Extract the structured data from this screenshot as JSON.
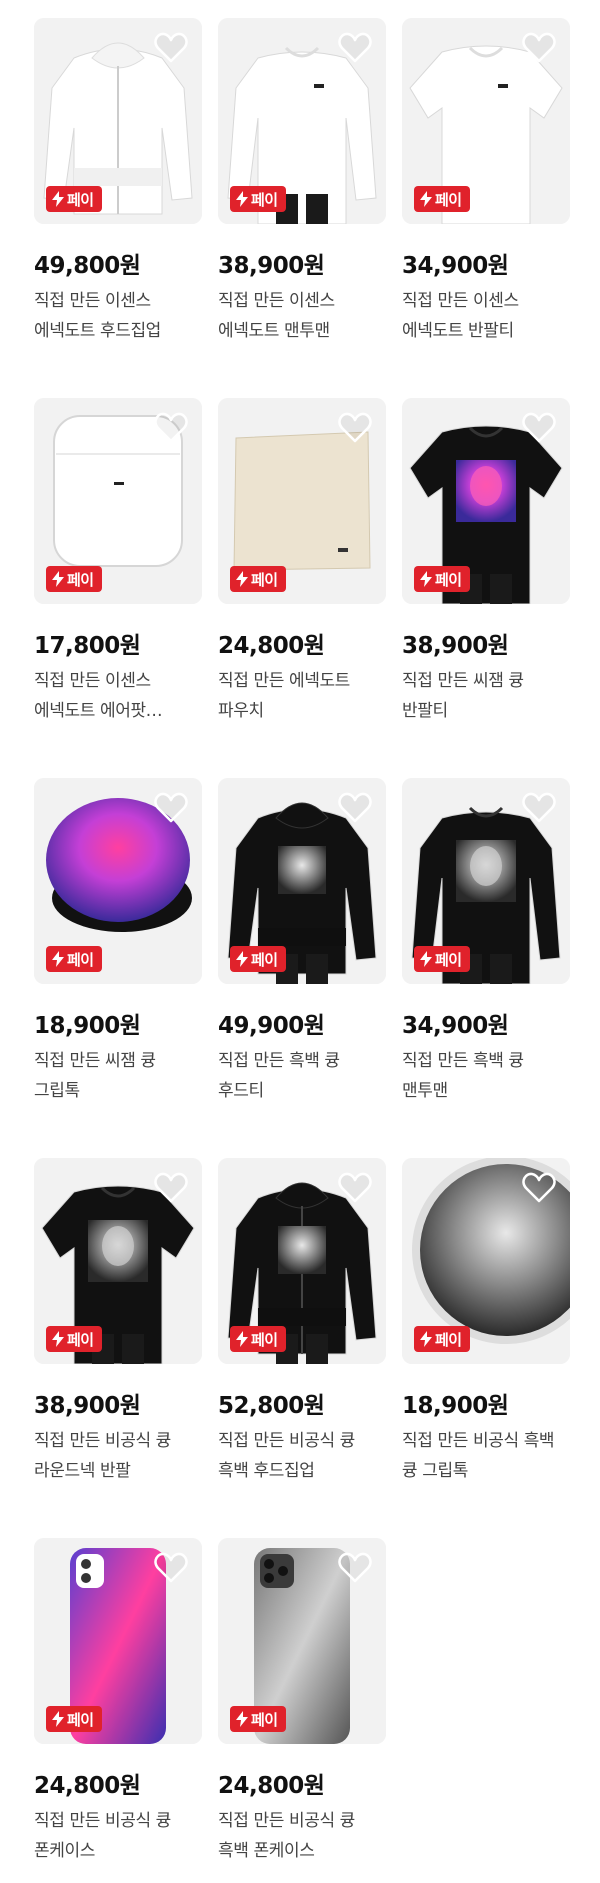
{
  "pay_label": "페이",
  "products": [
    {
      "price": "49,800원",
      "line1": "직접 만든 이센스",
      "line2": "에넥도트 후드집업",
      "art": "white-zip",
      "icon": "product-image"
    },
    {
      "price": "38,900원",
      "line1": "직접 만든 이센스",
      "line2": "에넥도트 맨투맨",
      "art": "white-sweat",
      "icon": "product-image"
    },
    {
      "price": "34,900원",
      "line1": "직접 만든 이센스",
      "line2": "에넥도트 반팔티",
      "art": "white-tee",
      "icon": "product-image"
    },
    {
      "price": "17,800원",
      "line1": "직접 만든 이센스",
      "line2": "에넥도트 에어팟…",
      "art": "airpods",
      "icon": "product-image"
    },
    {
      "price": "24,800원",
      "line1": "직접 만든 에넥도트",
      "line2": "파우치",
      "art": "pouch",
      "icon": "product-image"
    },
    {
      "price": "38,900원",
      "line1": "직접 만든 씨잼 큥",
      "line2": "반팔티",
      "art": "black-tee-color",
      "icon": "product-image"
    },
    {
      "price": "18,900원",
      "line1": "직접 만든 씨잼  큥",
      "line2": "그립톡",
      "art": "griptok-color",
      "icon": "product-image"
    },
    {
      "price": "49,900원",
      "line1": "직접 만든 흑백 큥",
      "line2": "후드티",
      "art": "black-hood",
      "icon": "product-image"
    },
    {
      "price": "34,900원",
      "line1": "직접 만든 흑백 큥",
      "line2": "맨투맨",
      "art": "black-sweat",
      "icon": "product-image"
    },
    {
      "price": "38,900원",
      "line1": "직접 만든 비공식 큥",
      "line2": "라운드넥 반팔",
      "art": "black-tee-gray",
      "icon": "product-image"
    },
    {
      "price": "52,800원",
      "line1": "직접 만든 비공식 큥",
      "line2": "흑백 후드집업",
      "art": "black-zip",
      "icon": "product-image"
    },
    {
      "price": "18,900원",
      "line1": "직접 만든 비공식 흑백",
      "line2": "큥 그립톡",
      "art": "griptok-gray",
      "icon": "product-image"
    },
    {
      "price": "24,800원",
      "line1": "직접 만든 비공식 큥",
      "line2": "폰케이스",
      "art": "phone-color",
      "icon": "product-image"
    },
    {
      "price": "24,800원",
      "line1": "직접 만든 비공식 큥",
      "line2": "흑백 폰케이스",
      "art": "phone-gray",
      "icon": "product-image"
    }
  ]
}
